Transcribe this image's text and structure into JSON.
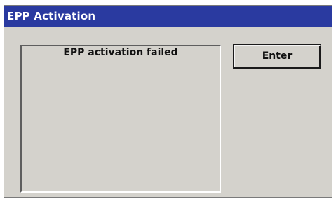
{
  "window": {
    "title": "EPP Activation",
    "title_bar_color": "#2a3aa0",
    "background_color": "#d4d2cc"
  },
  "message": {
    "text": "EPP activation failed"
  },
  "actions": {
    "enter_label": "Enter"
  }
}
